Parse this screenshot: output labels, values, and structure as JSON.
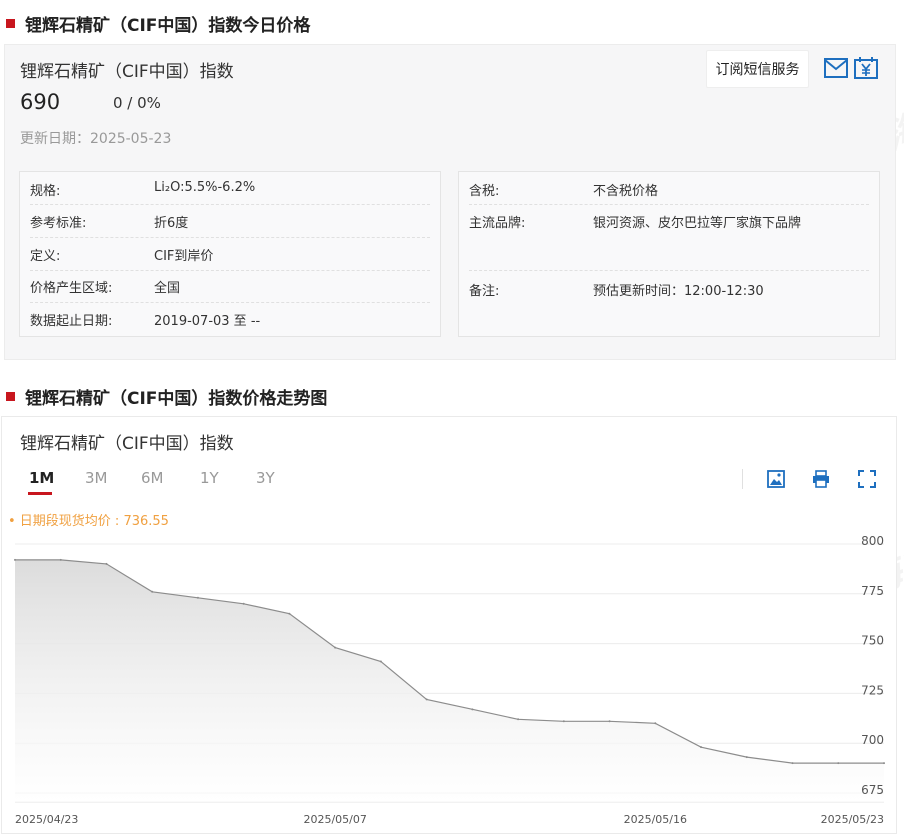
{
  "section1_title": "锂辉石精矿（CIF中国）指数今日价格",
  "section2_title": "锂辉石精矿（CIF中国）指数价格走势图",
  "price_card": {
    "name": "锂辉石精矿（CIF中国）指数",
    "price": "690",
    "change": "0 / 0%",
    "update_date": "更新日期：2025-05-23",
    "subscribe_label": "订阅短信服务"
  },
  "info_left": [
    {
      "key": "规格:",
      "value": "Li₂O:5.5%-6.2%"
    },
    {
      "key": "参考标准:",
      "value": "折6度"
    },
    {
      "key": "定义:",
      "value": "CIF到岸价"
    },
    {
      "key": "价格产生区域:",
      "value": "全国"
    },
    {
      "key": "数据起止日期:",
      "value": "2019-07-03 至 --"
    }
  ],
  "info_right": [
    {
      "key": "含税:",
      "value": "不含税价格"
    },
    {
      "key": "主流品牌:",
      "value": "银河资源、皮尔巴拉等厂家旗下品牌"
    },
    {
      "key": "备注:",
      "value": "预估更新时间：12:00-12:30"
    }
  ],
  "chart_panel": {
    "name": "锂辉石精矿（CIF中国）指数",
    "tabs": [
      "1M",
      "3M",
      "6M",
      "1Y",
      "3Y"
    ],
    "active_tab": "1M",
    "avg_label": "• 日期段现货均价 : 736.55"
  },
  "watermark": "SMM 上海有色网",
  "colors": {
    "accent": "#c8161e",
    "line": "#8c8c8c",
    "avg": "#f0a040",
    "icon": "#1e6fbf"
  },
  "chart_data": {
    "type": "area",
    "x": [
      "2025/04/23",
      "2025/04/24",
      "2025/04/25",
      "2025/04/28",
      "2025/04/29",
      "2025/04/30",
      "2025/05/06",
      "2025/05/07",
      "2025/05/08",
      "2025/05/09",
      "2025/05/12",
      "2025/05/13",
      "2025/05/14",
      "2025/05/15",
      "2025/05/16",
      "2025/05/19",
      "2025/05/20",
      "2025/05/21",
      "2025/05/22",
      "2025/05/23"
    ],
    "series": [
      {
        "values": [
          792,
          792,
          790,
          776,
          773,
          770,
          765,
          748,
          741,
          722,
          717,
          712,
          711,
          711,
          710,
          698,
          693,
          690,
          690,
          690
        ]
      }
    ],
    "x_tick_labels": [
      "2025/04/23",
      "2025/05/07",
      "2025/05/16",
      "2025/05/23"
    ],
    "y_ticks": [
      675,
      700,
      725,
      750,
      775,
      800
    ],
    "ylim": [
      675,
      800
    ],
    "grid": true
  }
}
